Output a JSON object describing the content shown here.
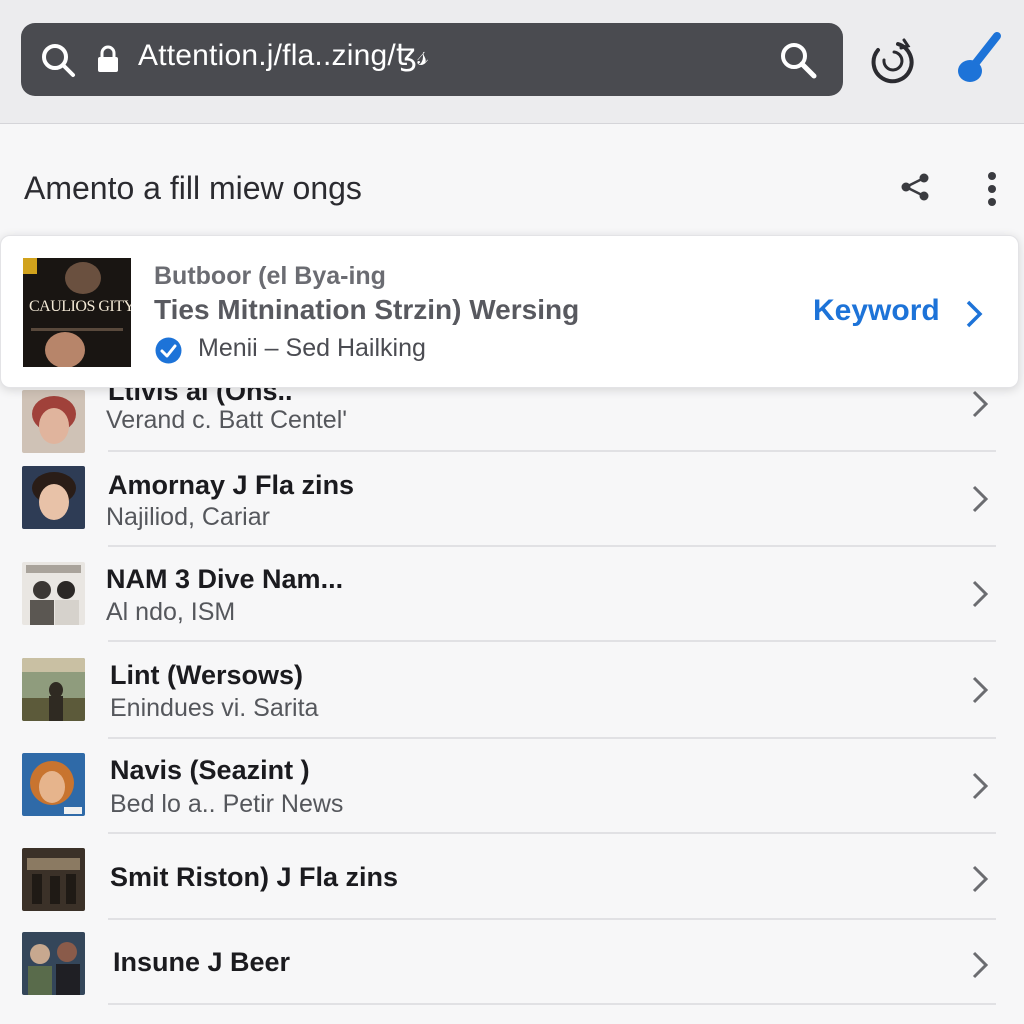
{
  "browser": {
    "url": "Attention.j/fla..zing/ꜩ𝓈",
    "icons": {
      "search": "search-icon",
      "lock": "lock-icon",
      "url_search": "search-icon",
      "reload": "reload-icon",
      "extension": "brush-icon"
    },
    "accent_color": "#1d73d8"
  },
  "section": {
    "title": "Amento a fill miew ongs",
    "icons": [
      "share-icon",
      "more-vertical-icon"
    ]
  },
  "featured": {
    "thumb_text": "CAULIOS GITY",
    "line1": "Butboor (el Bya-ing",
    "line2": "Ties Mitnination Strzin) Wersing",
    "line3": "Menii – Sed Hailking",
    "action": "Keyword"
  },
  "items": [
    {
      "title": "Ltivis al (Ons..",
      "subtitle": "Verand c. Batt Centel'"
    },
    {
      "title": "Amornay J Fla zins",
      "subtitle": "Najiliod, Cariar"
    },
    {
      "title": "NAM 3 Dive Nam...",
      "subtitle": "Al ndo, ISM"
    },
    {
      "title": "Lint (Wersows)",
      "subtitle": "Enindues vi. Sarita"
    },
    {
      "title": "Navis (Seazint )",
      "subtitle": "Bed lo a.. Petir News"
    },
    {
      "title": "Smit Riston) J Fla zins",
      "subtitle": ""
    },
    {
      "title": "Insune J Beer",
      "subtitle": ""
    }
  ]
}
